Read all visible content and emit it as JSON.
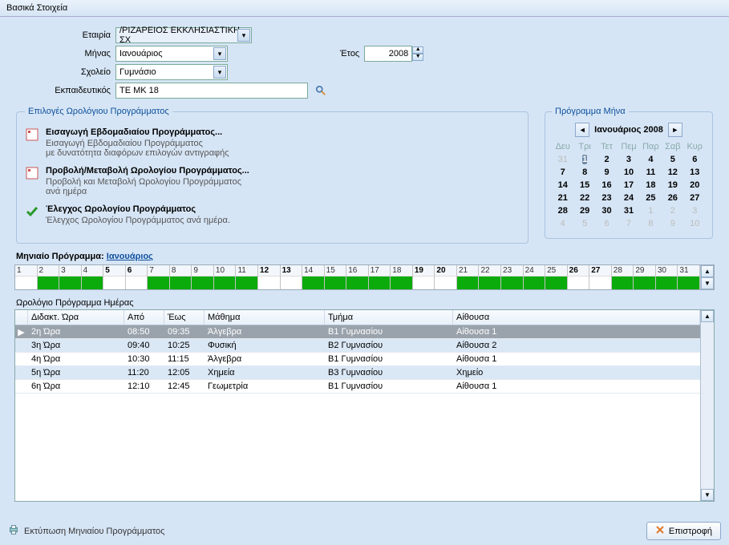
{
  "title": "Βασικά Στοιχεία",
  "form": {
    "company_label": "Εταιρία",
    "company_value": "/ΡΙΖΑΡΕΙΟΣ ΕΚΚΛΗΣΙΑΣΤΙΚΗ ΣΧ",
    "month_label": "Μήνας",
    "month_value": "Ιανουάριος",
    "school_label": "Σχολείο",
    "school_value": "Γυμνάσιο",
    "teacher_label": "Εκπαιδευτικός",
    "teacher_value": "TE MK 18",
    "year_label": "Έτος",
    "year_value": "2008"
  },
  "opts": {
    "legend": "Επιλογές Ωρολόγιου Προγράμματος",
    "items": [
      {
        "title": "Εισαγωγή Εβδομαδιαίου Προγράμματος...",
        "desc": "Εισαγωγή Εβδομαδιαίου Προγράμματος\nμε δυνατότητα διαφόρων επιλογών αντιγραφής"
      },
      {
        "title": "Προβολή/Μεταβολή Ωρολογίου Προγράμματος...",
        "desc": "Προβολή και Μεταβολή Ωρολογίου Προγράμματος\nανά ημέρα"
      },
      {
        "title": "Έλεγχος Ωρολογίου Προγράμματος",
        "desc": "Έλεγχος Ωρολογίου Προγράμματος ανά ημέρα."
      }
    ]
  },
  "cal": {
    "legend": "Πρόγραμμα Μήνα",
    "header": "Ιανουάριος 2008",
    "dow": [
      "Δευ",
      "Τρι",
      "Τετ",
      "Πεμ",
      "Παρ",
      "Σαβ",
      "Κυρ"
    ],
    "weeks": [
      [
        {
          "d": 31,
          "o": 1
        },
        {
          "d": 1,
          "s": 1
        },
        {
          "d": 2
        },
        {
          "d": 3
        },
        {
          "d": 4
        },
        {
          "d": 5
        },
        {
          "d": 6
        }
      ],
      [
        {
          "d": 7
        },
        {
          "d": 8
        },
        {
          "d": 9
        },
        {
          "d": 10
        },
        {
          "d": 11
        },
        {
          "d": 12
        },
        {
          "d": 13
        }
      ],
      [
        {
          "d": 14
        },
        {
          "d": 15
        },
        {
          "d": 16
        },
        {
          "d": 17
        },
        {
          "d": 18
        },
        {
          "d": 19
        },
        {
          "d": 20
        }
      ],
      [
        {
          "d": 21
        },
        {
          "d": 22
        },
        {
          "d": 23
        },
        {
          "d": 24
        },
        {
          "d": 25
        },
        {
          "d": 26
        },
        {
          "d": 27
        }
      ],
      [
        {
          "d": 28
        },
        {
          "d": 29
        },
        {
          "d": 30
        },
        {
          "d": 31
        },
        {
          "d": 1,
          "o": 1
        },
        {
          "d": 2,
          "o": 1
        },
        {
          "d": 3,
          "o": 1
        }
      ],
      [
        {
          "d": 4,
          "o": 1
        },
        {
          "d": 5,
          "o": 1
        },
        {
          "d": 6,
          "o": 1
        },
        {
          "d": 7,
          "o": 1
        },
        {
          "d": 8,
          "o": 1
        },
        {
          "d": 9,
          "o": 1
        },
        {
          "d": 10,
          "o": 1
        }
      ]
    ]
  },
  "monthbar": {
    "label": "Μηνιαίο Πρόγραμμα:",
    "link": "Ιανουάριος"
  },
  "days": [
    {
      "n": 1,
      "c": "white",
      "b": 0
    },
    {
      "n": 2,
      "c": "green",
      "b": 0
    },
    {
      "n": 3,
      "c": "green",
      "b": 0
    },
    {
      "n": 4,
      "c": "green",
      "b": 0
    },
    {
      "n": 5,
      "c": "white",
      "b": 1
    },
    {
      "n": 6,
      "c": "white",
      "b": 1
    },
    {
      "n": 7,
      "c": "green",
      "b": 0
    },
    {
      "n": 8,
      "c": "green",
      "b": 0
    },
    {
      "n": 9,
      "c": "green",
      "b": 0
    },
    {
      "n": 10,
      "c": "green",
      "b": 0
    },
    {
      "n": 11,
      "c": "green",
      "b": 0
    },
    {
      "n": 12,
      "c": "white",
      "b": 1
    },
    {
      "n": 13,
      "c": "white",
      "b": 1
    },
    {
      "n": 14,
      "c": "green",
      "b": 0
    },
    {
      "n": 15,
      "c": "green",
      "b": 0
    },
    {
      "n": 16,
      "c": "green",
      "b": 0
    },
    {
      "n": 17,
      "c": "green",
      "b": 0
    },
    {
      "n": 18,
      "c": "green",
      "b": 0
    },
    {
      "n": 19,
      "c": "white",
      "b": 1
    },
    {
      "n": 20,
      "c": "white",
      "b": 1
    },
    {
      "n": 21,
      "c": "green",
      "b": 0
    },
    {
      "n": 22,
      "c": "green",
      "b": 0
    },
    {
      "n": 23,
      "c": "green",
      "b": 0
    },
    {
      "n": 24,
      "c": "green",
      "b": 0
    },
    {
      "n": 25,
      "c": "green",
      "b": 0
    },
    {
      "n": 26,
      "c": "white",
      "b": 1
    },
    {
      "n": 27,
      "c": "white",
      "b": 1
    },
    {
      "n": 28,
      "c": "green",
      "b": 0
    },
    {
      "n": 29,
      "c": "green",
      "b": 0
    },
    {
      "n": 30,
      "c": "green",
      "b": 0
    },
    {
      "n": 31,
      "c": "green",
      "b": 0
    }
  ],
  "grid": {
    "title": "Ωρολόγιο Πρόγραμμα Ημέρας",
    "headers": {
      "hr": "Διδακτ. Ώρα",
      "ap": "Από",
      "ew": "Έως",
      "ma": "Μάθημα",
      "tm": "Τμήμα",
      "ai": "Αίθουσα"
    },
    "rows": [
      {
        "hr": "2η Ώρα",
        "ap": "08:50",
        "ew": "09:35",
        "ma": "Άλγεβρα",
        "tm": "Β1 Γυμνασίου",
        "ai": "Αίθουσα 1",
        "sel": 1
      },
      {
        "hr": "3η Ώρα",
        "ap": "09:40",
        "ew": "10:25",
        "ma": "Φυσική",
        "tm": "Β2 Γυμνασίου",
        "ai": "Αίθουσα 2"
      },
      {
        "hr": "4η Ώρα",
        "ap": "10:30",
        "ew": "11:15",
        "ma": "Άλγεβρα",
        "tm": "Β1 Γυμνασίου",
        "ai": "Αίθουσα 1"
      },
      {
        "hr": "5η Ώρα",
        "ap": "11:20",
        "ew": "12:05",
        "ma": "Χημεία",
        "tm": "Β3 Γυμνασίου",
        "ai": "Χημείο"
      },
      {
        "hr": "6η Ώρα",
        "ap": "12:10",
        "ew": "12:45",
        "ma": "Γεωμετρία",
        "tm": "Β1 Γυμνασίου",
        "ai": "Αίθουσα 1"
      }
    ]
  },
  "footer": {
    "print": "Εκτύπωση Μηνιαίου Προγράμματος",
    "back": "Επιστροφή"
  }
}
